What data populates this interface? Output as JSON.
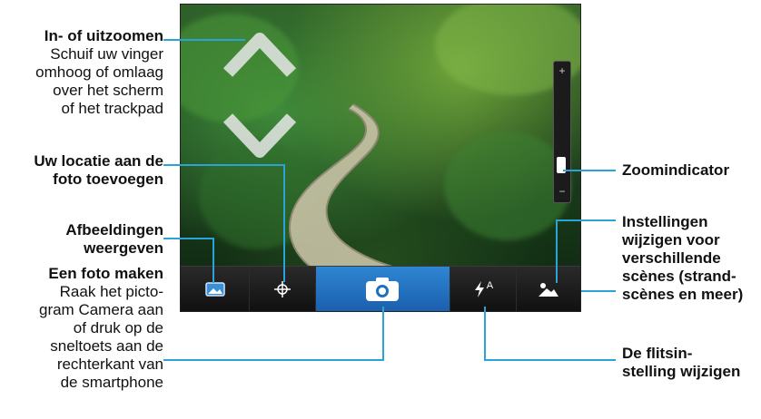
{
  "labels": {
    "zoom": {
      "title": "In- of uitzoomen",
      "lines": [
        "Schuif uw vinger",
        "omhoog of omlaag",
        "over het scherm",
        "of het trackpad"
      ]
    },
    "location": {
      "lines": [
        "Uw locatie aan de",
        "foto toevoegen"
      ]
    },
    "view_images": {
      "lines": [
        "Afbeeldingen",
        "weergeven"
      ]
    },
    "take_photo": {
      "title": "Een foto maken",
      "lines": [
        "Raak het picto-",
        "gram Camera aan",
        "of druk op de",
        "sneltoets aan de",
        "rechterkant van",
        "de smartphone"
      ]
    },
    "zoom_indicator": {
      "title": "Zoomindicator"
    },
    "scenes": {
      "lines": [
        "Instellingen",
        "wijzigen voor",
        "verschillende",
        "scènes (strand-",
        "scènes en meer)"
      ]
    },
    "flash": {
      "lines": [
        "De flitsin-",
        "stelling wijzigen"
      ]
    }
  },
  "toolbar": {
    "items": [
      {
        "name": "view-images",
        "icon": "image-gallery-icon"
      },
      {
        "name": "geotag",
        "icon": "crosshair-icon"
      },
      {
        "name": "shutter",
        "icon": "camera-icon"
      },
      {
        "name": "flash",
        "icon": "flash-auto-icon",
        "text": "A"
      },
      {
        "name": "scene",
        "icon": "mountain-scene-icon"
      }
    ]
  },
  "zoom": {
    "plus": "+",
    "minus": "−",
    "level": 0.05
  },
  "colors": {
    "accent": "#2aa3d8",
    "active_button": "#1f6fbf"
  }
}
